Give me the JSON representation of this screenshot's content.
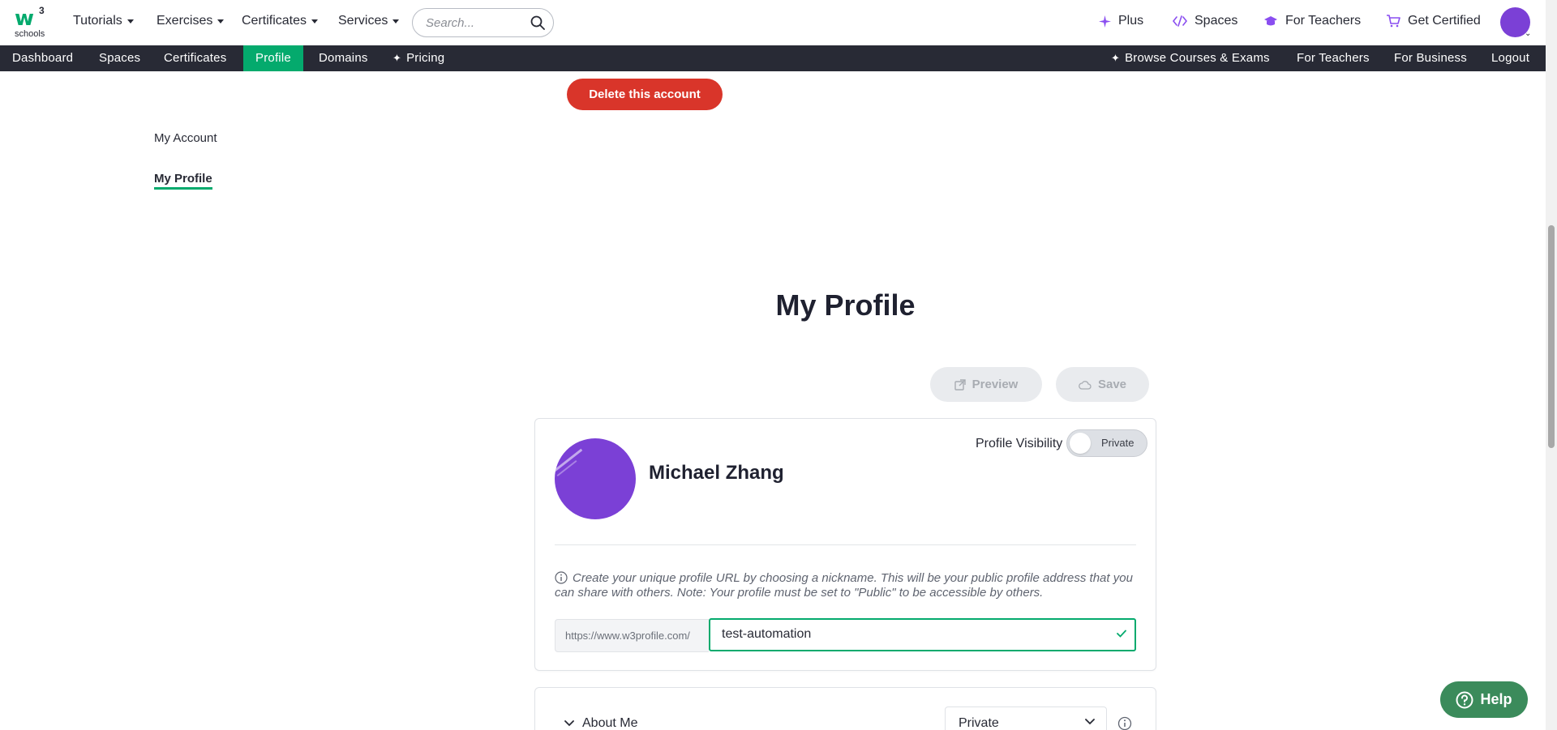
{
  "logo": {
    "main": "w",
    "sup": "3",
    "sub": "schools"
  },
  "topnav": {
    "tutorials": "Tutorials",
    "exercises": "Exercises",
    "certificates": "Certificates",
    "services": "Services",
    "search_placeholder": "Search...",
    "plus": "Plus",
    "spaces": "Spaces",
    "for_teachers": "For Teachers",
    "get_certified": "Get Certified"
  },
  "darknav": {
    "left": [
      "Dashboard",
      "Spaces",
      "Certificates",
      "Profile",
      "Domains",
      "Pricing"
    ],
    "active": "Profile",
    "right": [
      "Browse Courses & Exams",
      "For Teachers",
      "For Business",
      "Logout"
    ]
  },
  "delete_button": "Delete this account",
  "sidenav": {
    "my_account": "My Account",
    "my_profile": "My Profile"
  },
  "page_title": "My Profile",
  "actions": {
    "preview": "Preview",
    "save": "Save"
  },
  "profile": {
    "name": "Michael Zhang",
    "visibility_label": "Profile Visibility",
    "visibility_value": "Private",
    "hint": "Create your unique profile URL by choosing a nickname. This will be your public profile address that you can share with others. Note: Your profile must be set to \"Public\" to be accessible by others.",
    "url_prefix": "https://www.w3profile.com/",
    "nickname": "test-automation",
    "avatar_color": "#7b40d6"
  },
  "about": {
    "title": "About Me",
    "visibility": "Private"
  },
  "help": "Help",
  "colors": {
    "brand_green": "#04aa6d",
    "danger": "#d9352a",
    "dark_nav": "#282a35",
    "purple": "#7b40d6"
  }
}
